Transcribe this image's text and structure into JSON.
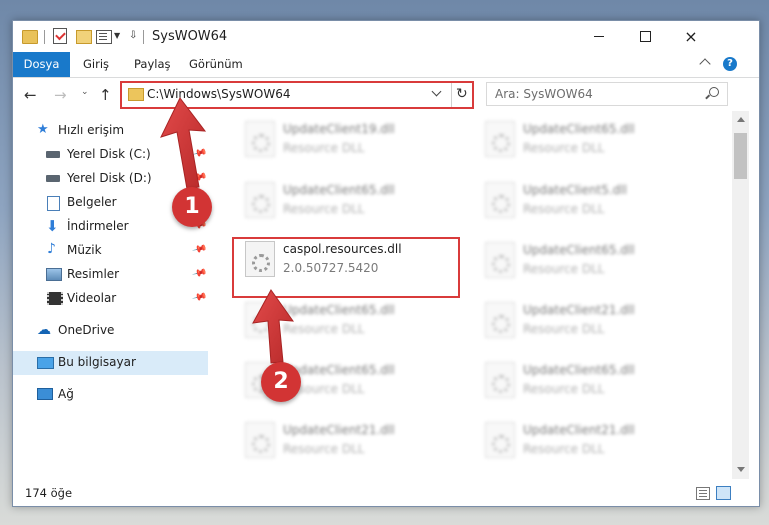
{
  "window": {
    "title": "SysWOW64",
    "controls": {
      "minimize": "minimize-icon",
      "maximize": "maximize-icon",
      "close": "×"
    }
  },
  "ribbon": {
    "tabs": [
      "Dosya",
      "Giriş",
      "Paylaş",
      "Görünüm"
    ],
    "help": "?"
  },
  "address": {
    "path": "C:\\Windows\\SysWOW64",
    "search_placeholder": "Ara: SysWOW64"
  },
  "sidebar": {
    "items": [
      {
        "label": "Hızlı erişim",
        "icon": "star-icon",
        "pinned": false
      },
      {
        "label": "Yerel Disk (C:)",
        "icon": "drive-icon",
        "pinned": true
      },
      {
        "label": "Yerel Disk (D:)",
        "icon": "drive-icon",
        "pinned": true
      },
      {
        "label": "Belgeler",
        "icon": "documents-icon",
        "pinned": true
      },
      {
        "label": "İndirmeler",
        "icon": "download-icon",
        "pinned": true
      },
      {
        "label": "Müzik",
        "icon": "music-icon",
        "pinned": true
      },
      {
        "label": "Resimler",
        "icon": "pictures-icon",
        "pinned": true
      },
      {
        "label": "Videolar",
        "icon": "videos-icon",
        "pinned": true
      },
      {
        "label": "OneDrive",
        "icon": "cloud-icon",
        "pinned": false
      },
      {
        "label": "Bu bilgisayar",
        "icon": "computer-icon",
        "pinned": false,
        "selected": true
      },
      {
        "label": "Ağ",
        "icon": "network-icon",
        "pinned": false
      }
    ]
  },
  "files": {
    "left_column": [
      {
        "name": "UpdateClient19.dll",
        "sub": "Resource DLL",
        "blurred": true
      },
      {
        "name": "UpdateClient65.dll",
        "sub": "Resource DLL",
        "blurred": true
      },
      {
        "name": "caspol.resources.dll",
        "sub": "2.0.50727.5420",
        "blurred": false,
        "highlighted": true
      },
      {
        "name": "UpdateClient65.dll",
        "sub": "Resource DLL",
        "blurred": true
      },
      {
        "name": "UpdateClient65.dll",
        "sub": "Resource DLL",
        "blurred": true
      },
      {
        "name": "UpdateClient21.dll",
        "sub": "Resource DLL",
        "blurred": true
      }
    ],
    "right_column": [
      {
        "name": "UpdateClient65.dll",
        "sub": "Resource DLL",
        "blurred": true
      },
      {
        "name": "UpdateClient5.dll",
        "sub": "Resource DLL",
        "blurred": true
      },
      {
        "name": "UpdateClient65.dll",
        "sub": "Resource DLL",
        "blurred": true
      },
      {
        "name": "UpdateClient21.dll",
        "sub": "Resource DLL",
        "blurred": true
      },
      {
        "name": "UpdateClient65.dll",
        "sub": "Resource DLL",
        "blurred": true
      },
      {
        "name": "UpdateClient21.dll",
        "sub": "Resource DLL",
        "blurred": true
      }
    ]
  },
  "status": {
    "count": "174 öğe"
  },
  "callouts": [
    {
      "number": "1"
    },
    {
      "number": "2"
    }
  ],
  "colors": {
    "accent": "#1979ca",
    "callout": "#d23434",
    "selection": "#d9ebf9"
  }
}
